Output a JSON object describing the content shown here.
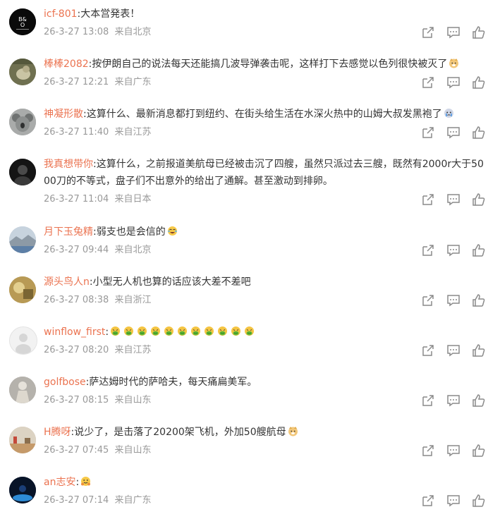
{
  "comments": [
    {
      "user": "icf-801",
      "text": "大本営発表！",
      "date": "26-3-27 13:08",
      "location": "来自北京",
      "avatar": "bo-logo"
    },
    {
      "user": "棒棒2082",
      "text": "按伊朗自己的说法每天还能搞几波导弹袭击呢，这样打下去感觉以色列很快被灭了",
      "date": "26-3-27 12:21",
      "location": "来自广东",
      "avatar": "bird-photo"
    },
    {
      "user": "神凝形散",
      "text": "这算什么、最新消息都打到纽约、在街头给生活在水深火热中的山姆大叔发黑袍了",
      "date": "26-3-27 11:40",
      "location": "来自江苏",
      "avatar": "koala-photo"
    },
    {
      "user": "我真想带你",
      "text": "这算什么，之前报道美航母已经被击沉了四艘，虽然只派过去三艘，既然有2000r大于5000刀的不等式，盘子们不出意外的给出了通解。甚至激动到排卵。",
      "date": "26-3-27 11:04",
      "location": "来自日本",
      "avatar": "dark-portrait"
    },
    {
      "user": "月下玉兔精",
      "text": "弱支也是会信的",
      "date": "26-3-27 09:44",
      "location": "来自北京",
      "avatar": "landscape-photo"
    },
    {
      "user": "源头鸟人n",
      "text": "小型无人机也算的话应该大差不差吧",
      "date": "26-3-27 08:38",
      "location": "来自浙江",
      "avatar": "gold-photo"
    },
    {
      "user": "winflow_first",
      "text": "",
      "date": "26-3-27 08:20",
      "location": "来自江苏",
      "avatar": "default-avatar"
    },
    {
      "user": "golfbose",
      "text": "萨达姆时代的萨哈夫，每天痛扁美军。",
      "date": "26-3-27 08:15",
      "location": "来自山东",
      "avatar": "statue-photo"
    },
    {
      "user": "H腾呀",
      "text": "说少了，是击落了20200架飞机，外加50艘航母",
      "date": "26-3-27 07:45",
      "location": "来自山东",
      "avatar": "beach-photo"
    },
    {
      "user": "an志安",
      "text": "",
      "date": "26-3-27 07:14",
      "location": "来自广东",
      "avatar": "blue-dark-photo"
    }
  ],
  "icons": {
    "share": "share-icon",
    "comment": "comment-icon",
    "like": "like-icon",
    "emoji_doge": "doge-emoji-icon",
    "emoji_tears": "tears-emoji-icon",
    "emoji_laugh": "laugh-cry-emoji-icon",
    "emoji_sick": "vomit-emoji-icon",
    "emoji_hug": "hug-emoji-icon"
  },
  "colors": {
    "username": "#eb7350",
    "meta": "#999999",
    "text": "#333333",
    "icon": "#8a8a8a"
  }
}
